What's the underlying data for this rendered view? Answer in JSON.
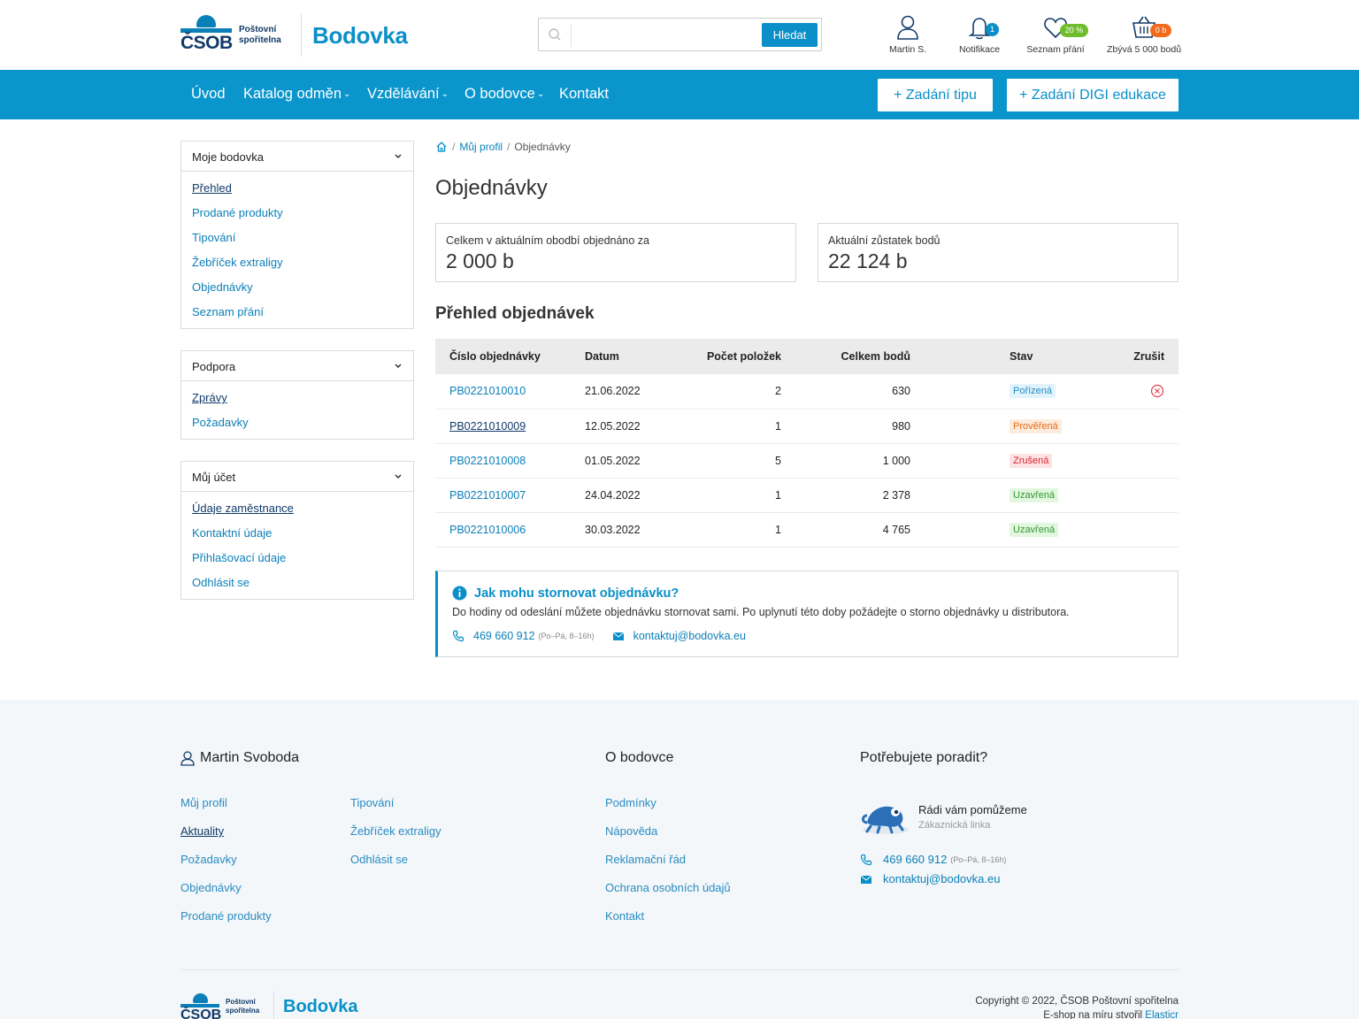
{
  "brand": {
    "bank_mark": "ČSOB",
    "bank_sub": "Poštovní spořitelna",
    "site_name": "Bodovka"
  },
  "search": {
    "placeholder": "",
    "button_label": "Hledat"
  },
  "header_icons": {
    "user": {
      "label": "Martin S."
    },
    "notifications": {
      "label": "Notifikace",
      "badge": "1"
    },
    "wishlist": {
      "label": "Seznam přání",
      "badge": "20 %"
    },
    "cart": {
      "label": "Zbývá 5 000 bodů",
      "badge": "0 b"
    }
  },
  "nav": {
    "items": [
      {
        "label": "Úvod",
        "has_dropdown": false
      },
      {
        "label": "Katalog odměn",
        "has_dropdown": true
      },
      {
        "label": "Vzdělávání",
        "has_dropdown": true
      },
      {
        "label": "O bodovce",
        "has_dropdown": true
      },
      {
        "label": "Kontakt",
        "has_dropdown": false
      }
    ],
    "cta_tip": "+ Zadání tipu",
    "cta_digi": "+ Zadání DIGI edukace"
  },
  "sidebar": {
    "sections": [
      {
        "title": "Moje bodovka",
        "links": [
          "Přehled",
          "Prodané produkty",
          "Tipování",
          "Žebříček extraligy",
          "Objednávky",
          "Seznam přání"
        ]
      },
      {
        "title": "Podpora",
        "links": [
          "Zprávy",
          "Požadavky"
        ]
      },
      {
        "title": "Můj účet",
        "links": [
          "Údaje zaměstnance",
          "Kontaktní údaje",
          "Přihlašovací údaje",
          "Odhlásit se"
        ]
      }
    ]
  },
  "breadcrumb": {
    "profile": "Můj profil",
    "current": "Objednávky"
  },
  "page": {
    "title": "Objednávky",
    "overview_title": "Přehled objednávek"
  },
  "stats": {
    "ordered": {
      "label": "Celkem v aktuálním obodbí objednáno za",
      "value": "2 000 b"
    },
    "balance": {
      "label": "Aktuální zůstatek bodů",
      "value": "22 124 b"
    }
  },
  "orders_table": {
    "headers": [
      "Číslo objednávky",
      "Datum",
      "Počet položek",
      "Celkem bodů",
      "Stav",
      "Zrušit"
    ],
    "rows": [
      {
        "number": "PB0221010010",
        "date": "21.06.2022",
        "items": "2",
        "points": "630",
        "status": "Pořízená",
        "status_color": "#1d8fc6",
        "cancelable": true
      },
      {
        "number": "PB0221010009",
        "date": "12.05.2022",
        "items": "1",
        "points": "980",
        "status": "Prověřená",
        "status_color": "#e86a16",
        "cancelable": false
      },
      {
        "number": "PB0221010008",
        "date": "01.05.2022",
        "items": "5",
        "points": "1 000",
        "status": "Zrušená",
        "status_color": "#d9272e",
        "cancelable": false
      },
      {
        "number": "PB0221010007",
        "date": "24.04.2022",
        "items": "1",
        "points": "2 378",
        "status": "Uzavřená",
        "status_color": "#2e9a2e",
        "cancelable": false
      },
      {
        "number": "PB0221010006",
        "date": "30.03.2022",
        "items": "1",
        "points": "4 765",
        "status": "Uzavřená",
        "status_color": "#2e9a2e",
        "cancelable": false
      }
    ]
  },
  "info": {
    "title": "Jak mohu stornovat objednávku?",
    "text": "Do hodiny od odeslání můžete objednávku stornovat sami. Po uplynutí této doby požádejte o storno objednávky u distributora.",
    "phone": "469 660 912",
    "hours": "(Po–Pá, 8–16h)",
    "email": "kontaktuj@bodovka.eu"
  },
  "footer": {
    "user_name": "Martin Svoboda",
    "user_links_col1": [
      "Můj profil",
      "Aktuality",
      "Požadavky",
      "Objednávky",
      "Prodané produkty"
    ],
    "user_links_col2": [
      "Tipování",
      "Žebříček extraligy",
      "Odhlásit se"
    ],
    "about_title": "O bodovce",
    "about_links": [
      "Podmínky",
      "Nápověda",
      "Reklamační řád",
      "Ochrana osobních údajů",
      "Kontakt"
    ],
    "help_title": "Potřebujete poradit?",
    "help_heading": "Rádi vám pomůžeme",
    "help_sub": "Zákaznická linka",
    "phone": "469 660 912",
    "hours": "(Po–Pá, 8–16h)",
    "email": "kontaktuj@bodovka.eu",
    "copyright": "Copyright © 2022, ČSOB Poštovní spořitelna",
    "made_by_prefix": "E-shop na míru stvořil",
    "made_by_link": "Elasticr"
  },
  "colors": {
    "brand_blue": "#0a96cd",
    "dark_blue": "#123a68",
    "link": "#0a7fb8"
  }
}
